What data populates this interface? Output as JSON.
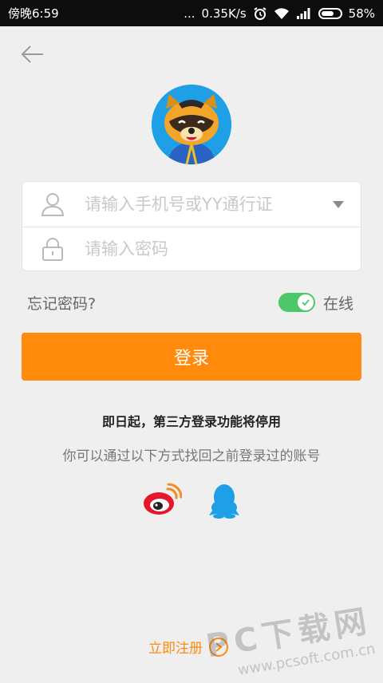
{
  "status_bar": {
    "time": "傍晚6:59",
    "dots": "...",
    "speed": "0.35K/s",
    "battery": "58%"
  },
  "form": {
    "account_placeholder": "请输入手机号或YY通行证",
    "password_placeholder": "请输入密码"
  },
  "options": {
    "forgot_password": "忘记密码?",
    "online_label": "在线"
  },
  "login_button": "登录",
  "notice": {
    "line1": "即日起，第三方登录功能将停用",
    "line2": "你可以通过以下方式找回之前登录过的账号"
  },
  "register_label": "立即注册",
  "watermark": {
    "line1": "PC下载网",
    "line2": "www.pcsoft.com.cn"
  },
  "colors": {
    "accent": "#ff8a0b",
    "toggle": "#4cc869",
    "weibo": "#e6162d",
    "qq": "#1fa0e6"
  }
}
